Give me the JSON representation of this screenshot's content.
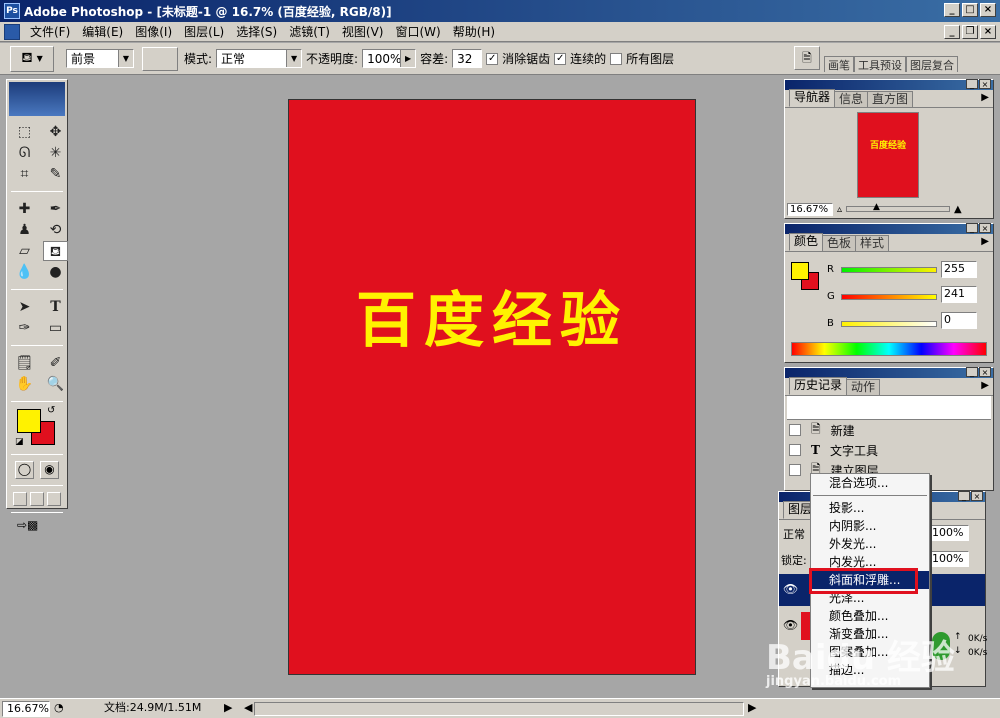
{
  "window": {
    "title": "Adobe Photoshop - [未标题-1 @ 16.7% (百度经验, RGB/8)]"
  },
  "menu": {
    "items": [
      "文件(F)",
      "编辑(E)",
      "图像(I)",
      "图层(L)",
      "选择(S)",
      "滤镜(T)",
      "视图(V)",
      "窗口(W)",
      "帮助(H)"
    ]
  },
  "options": {
    "fill_source": "前景",
    "mode_label": "模式:",
    "mode_value": "正常",
    "opacity_label": "不透明度:",
    "opacity_value": "100%",
    "tolerance_label": "容差:",
    "tolerance_value": "32",
    "antialias_label": "消除锯齿",
    "antialias_checked": true,
    "contiguous_label": "连续的",
    "contiguous_checked": true,
    "all_layers_label": "所有图层",
    "all_layers_checked": false,
    "palette_well_tabs": [
      "画笔",
      "工具预设",
      "图层复合"
    ]
  },
  "document": {
    "text": "百度经验",
    "background_color": "#e0101e",
    "text_color": "#fff200"
  },
  "navigator": {
    "tabs": [
      "导航器",
      "信息",
      "直方图"
    ],
    "thumb_text": "百度经验",
    "zoom": "16.67%"
  },
  "color_panel": {
    "tabs": [
      "颜色",
      "色板",
      "样式"
    ],
    "r_label": "R",
    "r_value": "255",
    "g_label": "G",
    "g_value": "241",
    "b_label": "B",
    "b_value": "0",
    "foreground": "#fff200",
    "background": "#e0101e"
  },
  "history_panel": {
    "tabs": [
      "历史记录",
      "动作"
    ],
    "items": [
      {
        "label": "新建",
        "icon": "document-icon"
      },
      {
        "label": "文字工具",
        "icon": "type-icon"
      },
      {
        "label": "建立图层",
        "icon": "document-icon"
      }
    ]
  },
  "layers_panel": {
    "tab": "图层",
    "blend_mode": "正常",
    "opacity": "100%",
    "lock_label": "锁定:",
    "fill": "100%"
  },
  "context_menu": {
    "items": [
      "混合选项...",
      "投影...",
      "内阴影...",
      "外发光...",
      "内发光...",
      "斜面和浮雕...",
      "光泽...",
      "颜色叠加...",
      "渐变叠加...",
      "图案叠加...",
      "描边..."
    ],
    "selected": "斜面和浮雕..."
  },
  "status": {
    "zoom": "16.67%",
    "doc_info": "文档:24.9M/1.51M"
  },
  "network": {
    "up": "0K/s",
    "down": "0K/s"
  },
  "watermark": {
    "brand": "Baidu 经验",
    "url": "jingyan.baidu.com"
  }
}
